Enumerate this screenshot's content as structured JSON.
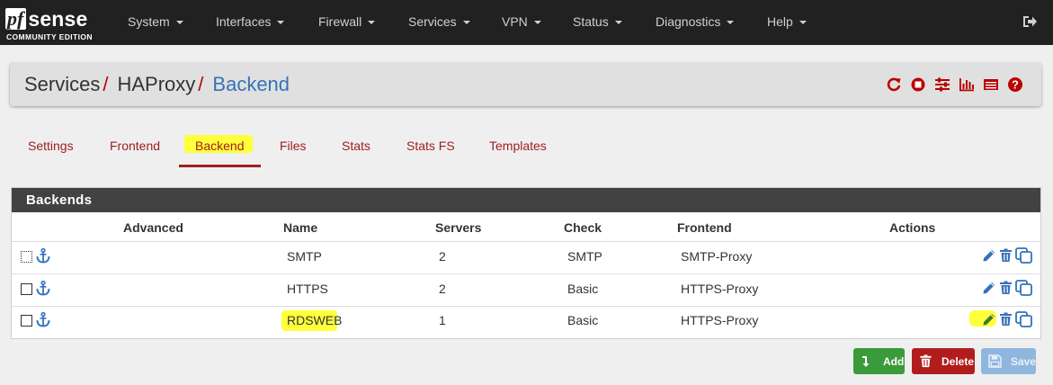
{
  "brand": {
    "logo_pf": "pf",
    "logo_sense": "sense",
    "edition": "COMMUNITY EDITION"
  },
  "nav": {
    "items": [
      {
        "label": "System"
      },
      {
        "label": "Interfaces"
      },
      {
        "label": "Firewall"
      },
      {
        "label": "Services"
      },
      {
        "label": "VPN"
      },
      {
        "label": "Status"
      },
      {
        "label": "Diagnostics"
      },
      {
        "label": "Help"
      }
    ],
    "logout_icon": "sign-out-icon"
  },
  "breadcrumb": {
    "level1": "Services",
    "level2": "HAProxy",
    "level3": "Backend",
    "separator": "/"
  },
  "header_icons": [
    "restart-service-icon",
    "stop-service-icon",
    "settings-sliders-icon",
    "bar-chart-icon",
    "log-icon",
    "help-icon"
  ],
  "tabs": [
    {
      "label": "Settings"
    },
    {
      "label": "Frontend"
    },
    {
      "label": "Backend",
      "active": true
    },
    {
      "label": "Files"
    },
    {
      "label": "Stats"
    },
    {
      "label": "Stats FS"
    },
    {
      "label": "Templates"
    }
  ],
  "panel": {
    "title": "Backends",
    "columns": [
      "Advanced",
      "Name",
      "Servers",
      "Check",
      "Frontend",
      "Actions"
    ],
    "rows": [
      {
        "name": "SMTP",
        "servers": "2",
        "check": "SMTP",
        "frontend": "SMTP-Proxy"
      },
      {
        "name": "HTTPS",
        "servers": "2",
        "check": "Basic",
        "frontend": "HTTPS-Proxy"
      },
      {
        "name": "RDSWEB",
        "servers": "1",
        "check": "Basic",
        "frontend": "HTTPS-Proxy"
      }
    ]
  },
  "buttons": {
    "add": "Add",
    "delete": "Delete",
    "save": "Save"
  },
  "colors": {
    "navbar": "#212121",
    "accent_red": "#a01f1f",
    "link_blue": "#3672b8",
    "highlight": "#ffff3b",
    "add_green": "#3b9a3b",
    "delete_red": "#b11d1d",
    "save_blue": "#8fb7de"
  }
}
